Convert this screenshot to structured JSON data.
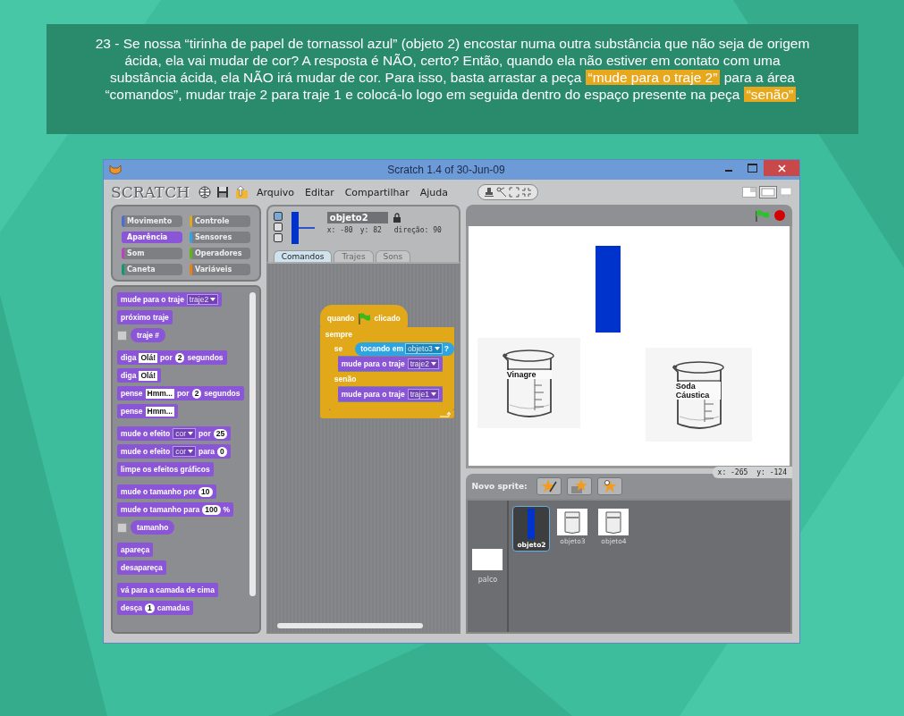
{
  "caption": [
    {
      "text": "23 - Se nossa “tirinha de papel de tornassol azul” (objeto 2) encostar numa outra substância que não seja de origem ácida, ela vai mudar de cor? A resposta é NÃO, certo? Então, quando ela não estiver em contato com uma substância ácida, ela NÃO irá mudar de cor. Para isso, basta arrastar a peça ",
      "highlight": false
    },
    {
      "text": "“mude para o traje 2”",
      "highlight": true
    },
    {
      "text": " para a área “comandos”, mudar traje 2 para traje 1 e colocá-lo logo em seguida dentro do espaço presente na peça ",
      "highlight": false
    },
    {
      "text": "“senão”",
      "highlight": true
    },
    {
      "text": ".",
      "highlight": false
    }
  ],
  "window": {
    "title": "Scratch 1.4 of 30-Jun-09"
  },
  "toolbar": {
    "logo": "SCRATCH",
    "menus": [
      "Arquivo",
      "Editar",
      "Compartilhar",
      "Ajuda"
    ]
  },
  "categories": [
    {
      "label": "Movimento",
      "color": "#4a6cd4",
      "selected": false
    },
    {
      "label": "Controle",
      "color": "#e1a91a",
      "selected": false
    },
    {
      "label": "Aparência",
      "color": "#8a55d7",
      "selected": true
    },
    {
      "label": "Sensores",
      "color": "#2ca5e2",
      "selected": false
    },
    {
      "label": "Som",
      "color": "#bb42c3",
      "selected": false
    },
    {
      "label": "Operadores",
      "color": "#5cb712",
      "selected": false
    },
    {
      "label": "Caneta",
      "color": "#0e9a6c",
      "selected": false
    },
    {
      "label": "Variáveis",
      "color": "#ee7d16",
      "selected": false
    }
  ],
  "palette": [
    [
      {
        "kind": "stack",
        "parts": [
          {
            "kind": "text",
            "text": "mude para o traje"
          },
          {
            "kind": "dropdown",
            "text": "traje2"
          }
        ]
      },
      {
        "kind": "stack",
        "parts": [
          {
            "kind": "text",
            "text": "próximo traje"
          }
        ]
      },
      {
        "kind": "reporter",
        "checked": false,
        "parts": [
          {
            "kind": "text",
            "text": "traje #"
          }
        ]
      }
    ],
    [
      {
        "kind": "stack",
        "parts": [
          {
            "kind": "text",
            "text": "diga"
          },
          {
            "kind": "field",
            "text": "Olá!"
          },
          {
            "kind": "text",
            "text": "por"
          },
          {
            "kind": "number",
            "text": "2"
          },
          {
            "kind": "text",
            "text": "segundos"
          }
        ]
      },
      {
        "kind": "stack",
        "parts": [
          {
            "kind": "text",
            "text": "diga"
          },
          {
            "kind": "field",
            "text": "Olá!"
          }
        ]
      },
      {
        "kind": "stack",
        "parts": [
          {
            "kind": "text",
            "text": "pense"
          },
          {
            "kind": "field",
            "text": "Hmm..."
          },
          {
            "kind": "text",
            "text": "por"
          },
          {
            "kind": "number",
            "text": "2"
          },
          {
            "kind": "text",
            "text": "segundos"
          }
        ]
      },
      {
        "kind": "stack",
        "parts": [
          {
            "kind": "text",
            "text": "pense"
          },
          {
            "kind": "field",
            "text": "Hmm..."
          }
        ]
      }
    ],
    [
      {
        "kind": "stack",
        "parts": [
          {
            "kind": "text",
            "text": "mude o efeito"
          },
          {
            "kind": "dropdown",
            "text": "cor"
          },
          {
            "kind": "text",
            "text": "por"
          },
          {
            "kind": "number",
            "text": "25"
          }
        ]
      },
      {
        "kind": "stack",
        "parts": [
          {
            "kind": "text",
            "text": "mude o efeito"
          },
          {
            "kind": "dropdown",
            "text": "cor"
          },
          {
            "kind": "text",
            "text": "para"
          },
          {
            "kind": "number",
            "text": "0"
          }
        ]
      },
      {
        "kind": "stack",
        "parts": [
          {
            "kind": "text",
            "text": "limpe os efeitos gráficos"
          }
        ]
      }
    ],
    [
      {
        "kind": "stack",
        "parts": [
          {
            "kind": "text",
            "text": "mude o tamanho por"
          },
          {
            "kind": "number",
            "text": "10"
          }
        ]
      },
      {
        "kind": "stack",
        "parts": [
          {
            "kind": "text",
            "text": "mude o tamanho para"
          },
          {
            "kind": "number",
            "text": "100"
          },
          {
            "kind": "text",
            "text": "%"
          }
        ]
      },
      {
        "kind": "reporter",
        "checked": false,
        "parts": [
          {
            "kind": "text",
            "text": "tamanho"
          }
        ]
      }
    ],
    [
      {
        "kind": "stack",
        "parts": [
          {
            "kind": "text",
            "text": "apareça"
          }
        ]
      },
      {
        "kind": "stack",
        "parts": [
          {
            "kind": "text",
            "text": "desapareça"
          }
        ]
      }
    ],
    [
      {
        "kind": "stack",
        "parts": [
          {
            "kind": "text",
            "text": "vá para a camada de cima"
          }
        ]
      },
      {
        "kind": "stack",
        "parts": [
          {
            "kind": "text",
            "text": "desça"
          },
          {
            "kind": "number",
            "text": "1"
          },
          {
            "kind": "text",
            "text": "camadas"
          }
        ]
      }
    ]
  ],
  "sprite_info": {
    "name": "objeto2",
    "x": "x: -80",
    "y": "y: 82",
    "direction": "direção: 90",
    "rotation_styles": [
      {
        "selected": true
      },
      {
        "selected": false
      },
      {
        "selected": false
      }
    ]
  },
  "tabs": [
    {
      "label": "Comandos",
      "selected": true
    },
    {
      "label": "Trajes",
      "selected": false
    },
    {
      "label": "Sons",
      "selected": false
    }
  ],
  "script": {
    "hat_before": "quando",
    "hat_after": "clicado",
    "loop_label": "sempre",
    "if_label": "se",
    "condition": {
      "text": "tocando em",
      "dropdown": "objeto3",
      "suffix": "?"
    },
    "then_block": {
      "text": "mude para o traje",
      "dropdown": "traje2"
    },
    "else_label": "senão",
    "else_block": {
      "text": "mude para o traje",
      "dropdown": "traje1"
    }
  },
  "stage": {
    "sprites": [
      {
        "kind": "bar"
      },
      {
        "kind": "beaker",
        "label": "Vinagre"
      },
      {
        "kind": "beaker",
        "label": "Soda Cáustica"
      }
    ]
  },
  "mouse": {
    "x": "x: -265",
    "y": "y: -124"
  },
  "new_sprite_label": "Novo sprite:",
  "sprites": [
    {
      "name": "objeto2",
      "kind": "bar",
      "selected": true
    },
    {
      "name": "objeto3",
      "kind": "beaker",
      "selected": false
    },
    {
      "name": "objeto4",
      "kind": "beaker",
      "selected": false
    }
  ],
  "stage_thumb": {
    "name": "palco"
  }
}
